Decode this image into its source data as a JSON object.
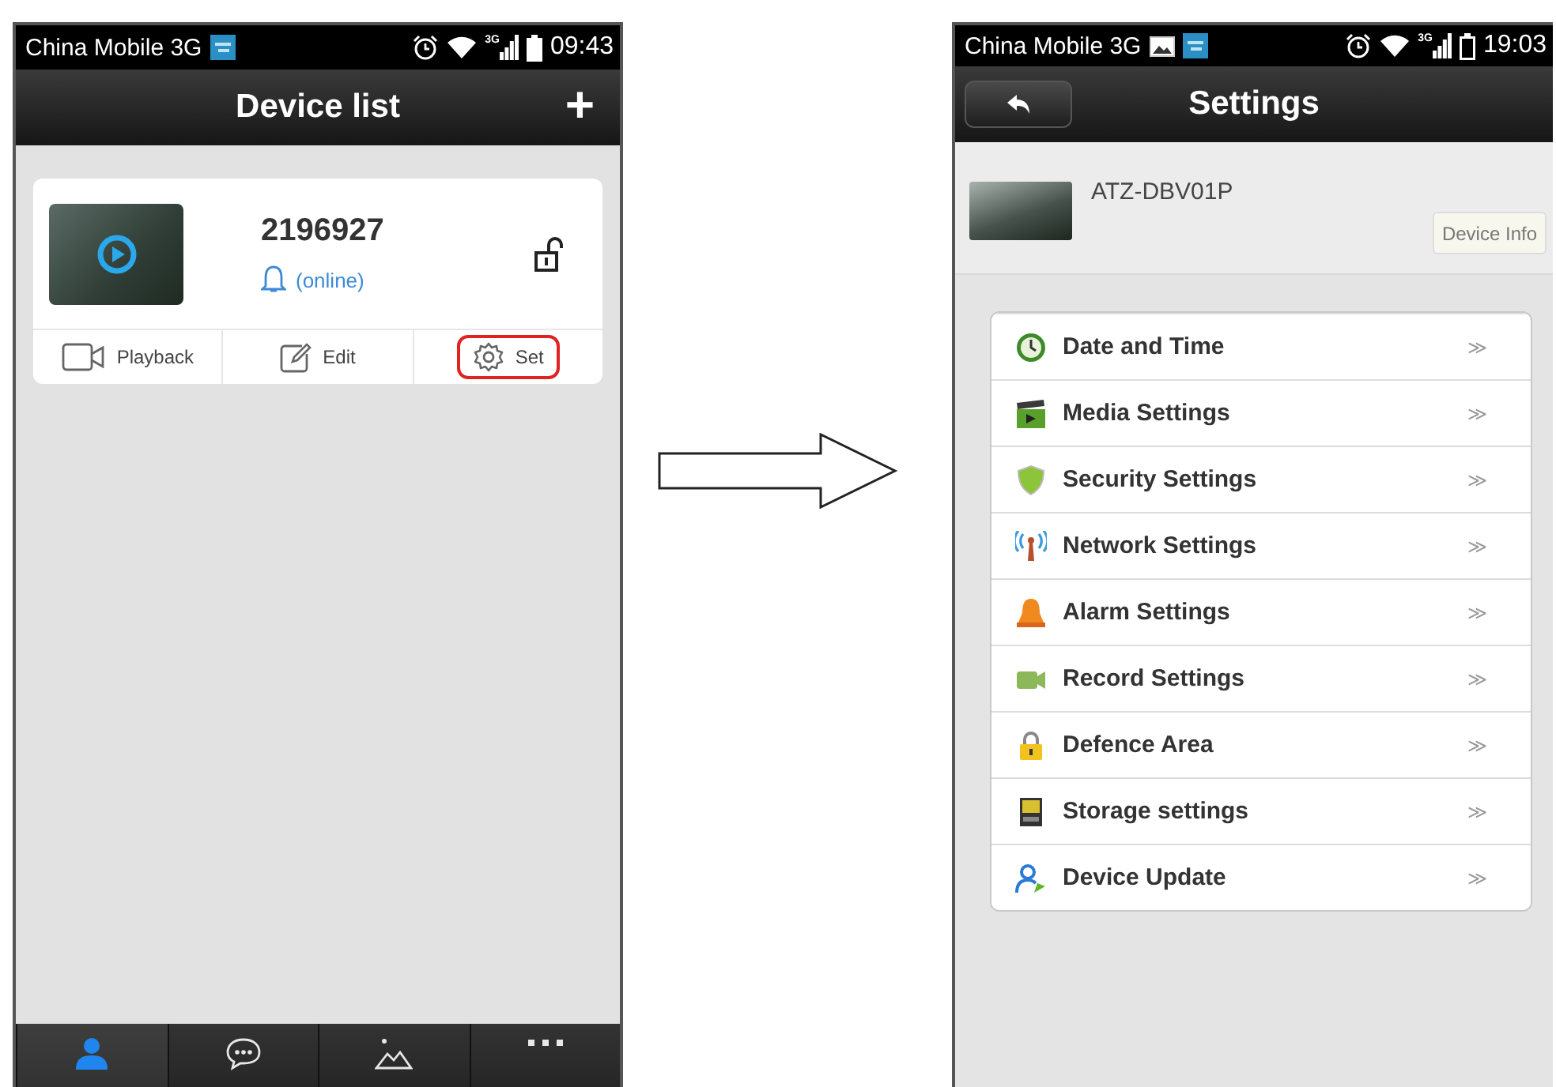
{
  "device_list_screen": {
    "status_bar": {
      "carrier": "China Mobile 3G",
      "network_type": "3G",
      "time": "09:43"
    },
    "title": "Device list",
    "add_button": "+",
    "device": {
      "name": "2196927",
      "status": "(online)"
    },
    "actions": [
      {
        "kind": "playback",
        "label": "Playback",
        "highlighted": false
      },
      {
        "kind": "edit",
        "label": "Edit",
        "highlighted": false
      },
      {
        "kind": "set",
        "label": "Set",
        "highlighted": true
      }
    ],
    "nav_tabs": [
      {
        "kind": "device",
        "selected": true
      },
      {
        "kind": "message",
        "selected": false
      },
      {
        "kind": "images",
        "selected": false
      },
      {
        "kind": "more",
        "selected": false
      }
    ]
  },
  "settings_screen": {
    "status_bar": {
      "carrier": "China Mobile 3G",
      "network_type": "3G",
      "time": "19:03"
    },
    "title": "Settings",
    "device": {
      "name": "ATZ-DBV01P",
      "info_button": "Device Info"
    },
    "items": [
      {
        "kind": "date",
        "label": "Date and Time",
        "chevron": "≫"
      },
      {
        "kind": "media",
        "label": "Media Settings",
        "chevron": "≫"
      },
      {
        "kind": "security",
        "label": "Security Settings",
        "chevron": "≫"
      },
      {
        "kind": "network",
        "label": "Network Settings",
        "chevron": "≫"
      },
      {
        "kind": "alarm",
        "label": "Alarm Settings",
        "chevron": "≫"
      },
      {
        "kind": "record",
        "label": "Record Settings",
        "chevron": "≫"
      },
      {
        "kind": "defence",
        "label": "Defence Area",
        "chevron": "≫"
      },
      {
        "kind": "storage",
        "label": "Storage settings",
        "chevron": "≫"
      },
      {
        "kind": "update",
        "label": "Device Update",
        "chevron": "≫"
      }
    ]
  }
}
